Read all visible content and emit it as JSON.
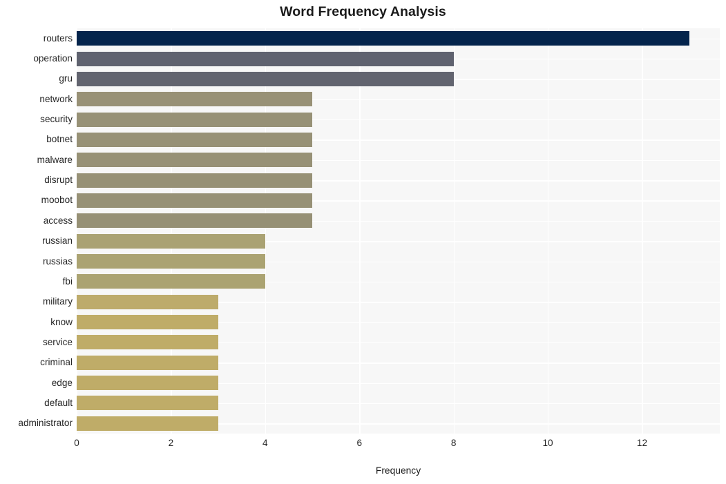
{
  "chart_data": {
    "type": "bar",
    "orientation": "horizontal",
    "title": "Word Frequency Analysis",
    "xlabel": "Frequency",
    "ylabel": "",
    "categories": [
      "routers",
      "operation",
      "gru",
      "network",
      "security",
      "botnet",
      "malware",
      "disrupt",
      "moobot",
      "access",
      "russian",
      "russias",
      "fbi",
      "military",
      "know",
      "service",
      "criminal",
      "edge",
      "default",
      "administrator"
    ],
    "values": [
      13,
      8,
      8,
      5,
      5,
      5,
      5,
      5,
      5,
      5,
      4,
      4,
      4,
      3,
      3,
      3,
      3,
      3,
      3,
      3
    ],
    "xticks": [
      0,
      2,
      4,
      6,
      8,
      10,
      12
    ],
    "xlim": [
      0,
      13.65
    ],
    "grid": true,
    "legend": false,
    "bar_colors": [
      "#04244c",
      "#5f626f",
      "#62646f",
      "#989176",
      "#979176",
      "#979176",
      "#979176",
      "#979176",
      "#979176",
      "#969075",
      "#aaa273",
      "#aba372",
      "#aba372",
      "#bdab6b",
      "#bfac68",
      "#bfac68",
      "#bfac68",
      "#bfac68",
      "#bfac68",
      "#bfac68"
    ],
    "plot_background": "#f7f7f7",
    "grid_color": "#ffffff",
    "figure_background": "#ffffff"
  }
}
